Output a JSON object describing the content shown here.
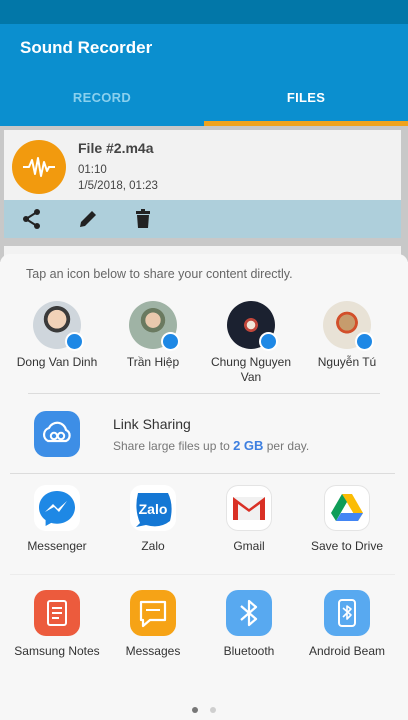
{
  "app": {
    "title": "Sound Recorder"
  },
  "tabs": [
    {
      "label": "RECORD",
      "selected": false
    },
    {
      "label": "FILES",
      "selected": true
    }
  ],
  "recording": {
    "name": "File #2.m4a",
    "duration": "01:10",
    "date": "1/5/2018, 01:23",
    "actions": [
      "share-icon",
      "edit-icon",
      "delete-icon"
    ]
  },
  "share_sheet": {
    "hint": "Tap an icon below to share your content directly.",
    "contacts": [
      {
        "name": "Dong Van Dinh",
        "badge": "messenger"
      },
      {
        "name": "Trần Hiệp",
        "badge": "messenger"
      },
      {
        "name": "Chung Nguyen Van",
        "badge": "messenger"
      },
      {
        "name": "Nguyễn Tú",
        "badge": "messenger"
      }
    ],
    "link_sharing": {
      "title": "Link Sharing",
      "desc_prefix": "Share large files up to ",
      "desc_size": "2 GB",
      "desc_suffix": " per day."
    },
    "apps": [
      {
        "label": "Messenger",
        "icon": "messenger-icon"
      },
      {
        "label": "Zalo",
        "icon": "zalo-icon"
      },
      {
        "label": "Gmail",
        "icon": "gmail-icon"
      },
      {
        "label": "Save to Drive",
        "icon": "drive-icon"
      },
      {
        "label": "Samsung Notes",
        "icon": "samsung-notes-icon"
      },
      {
        "label": "Messages",
        "icon": "messages-icon"
      },
      {
        "label": "Bluetooth",
        "icon": "bluetooth-icon"
      },
      {
        "label": "Android Beam",
        "icon": "android-beam-icon"
      }
    ],
    "pages": {
      "count": 2,
      "current": 1
    }
  },
  "colors": {
    "appbar": "#0b8fcf",
    "tab_indicator": "#f0a31d",
    "file_icon": "#f29a0e",
    "messenger": "#1e88e5",
    "link_sharing": "#3d8ee6"
  }
}
